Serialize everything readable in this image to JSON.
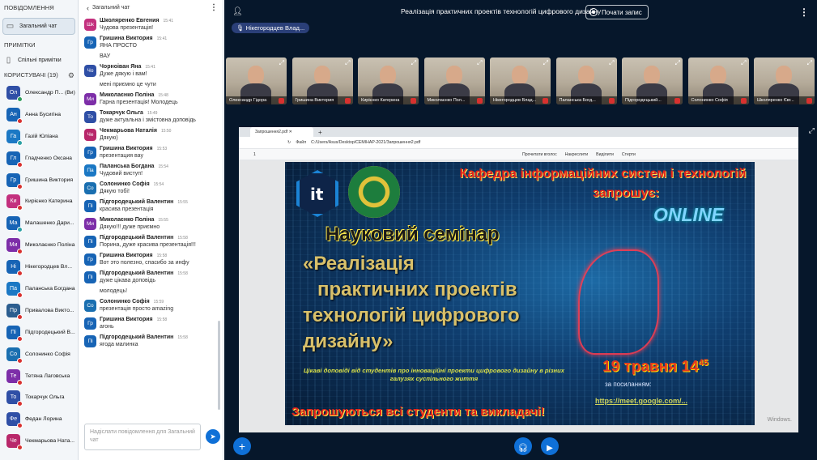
{
  "sidebar": {
    "messages_header": "ПОВІДОМЛЕННЯ",
    "general_chat": "Загальний чат",
    "notes_header": "ПРИМІТКИ",
    "shared_notes": "Спільні примітки",
    "users_header": "КОРИСТУВАЧІ (19)",
    "users": [
      {
        "initials": "Ол",
        "name": "Олександр П... (Ви)",
        "color": "#2f4fa6",
        "status": "green"
      },
      {
        "initials": "Ан",
        "name": "Анна Бусигіна",
        "color": "#1764b5",
        "status": "red"
      },
      {
        "initials": "Га",
        "name": "Газій Юліана",
        "color": "#1b78c4",
        "status": "teal"
      },
      {
        "initials": "Гл",
        "name": "Гладченко Оксана",
        "color": "#1764b5",
        "status": "red"
      },
      {
        "initials": "Гр",
        "name": "Гришина Виктория",
        "color": "#1764b5",
        "status": "red"
      },
      {
        "initials": "Ки",
        "name": "Кирiєнко Катерина",
        "color": "#c3307e",
        "status": "red"
      },
      {
        "initials": "Ма",
        "name": "Малашенко Дари...",
        "color": "#1764b5",
        "status": "teal"
      },
      {
        "initials": "Ми",
        "name": "Миколаєнко Поліна",
        "color": "#7d2ea8",
        "status": "red"
      },
      {
        "initials": "Ні",
        "name": "Нікегородцев Вл...",
        "color": "#1764b5",
        "status": "red"
      },
      {
        "initials": "Па",
        "name": "Паланська Богдана",
        "color": "#1b78c4",
        "status": "red"
      },
      {
        "initials": "Пр",
        "name": "Привалова Викто...",
        "color": "#2b5d8f",
        "status": "red"
      },
      {
        "initials": "Пі",
        "name": "Підгородецький В...",
        "color": "#1764b5",
        "status": "red"
      },
      {
        "initials": "Со",
        "name": "Солонинко Софія",
        "color": "#1a6fb0",
        "status": "red"
      },
      {
        "initials": "Те",
        "name": "Тетяна Лаговська",
        "color": "#7d2ea8",
        "status": "red"
      },
      {
        "initials": "То",
        "name": "Токарчук Ольга",
        "color": "#2f4fa6",
        "status": "red"
      },
      {
        "initials": "Фе",
        "name": "Федан Лорина",
        "color": "#2f4fa6",
        "status": "red"
      },
      {
        "initials": "Че",
        "name": "Чекмарьова Ната...",
        "color": "#b8276a",
        "status": "red"
      }
    ]
  },
  "chat": {
    "title": "Загальний чат",
    "messages": [
      {
        "initials": "Шк",
        "color": "#c3307e",
        "name": "Школяренко Евгения",
        "time": "15:41",
        "text": "Чудова презентація!"
      },
      {
        "initials": "Гр",
        "color": "#1764b5",
        "name": "Гришина Виктория",
        "time": "15:41",
        "text": "ЯНА ПРОСТО",
        "cont": "ВАУ"
      },
      {
        "initials": "Чо",
        "color": "#2f4fa6",
        "name": "Чорноіван Яна",
        "time": "15:41",
        "text": "Дуже дякую і вам!",
        "cont": "мені приємно це чути"
      },
      {
        "initials": "Ми",
        "color": "#7d2ea8",
        "name": "Миколаєнко Поліна",
        "time": "15:48",
        "text": "Гарна презентація! Молодець"
      },
      {
        "initials": "То",
        "color": "#2f4fa6",
        "name": "Токарчук Ольга",
        "time": "15:49",
        "text": "дуже актуальна і змістовна доповідь"
      },
      {
        "initials": "Че",
        "color": "#b8276a",
        "name": "Чекмарьова Наталія",
        "time": "15:50",
        "text": "Дякую)"
      },
      {
        "initials": "Гр",
        "color": "#1764b5",
        "name": "Гришина Виктория",
        "time": "15:53",
        "text": "презентация вау"
      },
      {
        "initials": "Па",
        "color": "#1b78c4",
        "name": "Паланська Богдана",
        "time": "15:54",
        "text": "Чудовий виступ!"
      },
      {
        "initials": "Со",
        "color": "#1a6fb0",
        "name": "Солонинко Софія",
        "time": "15:54",
        "text": "Дякую тобі!"
      },
      {
        "initials": "Пі",
        "color": "#1764b5",
        "name": "Підгородецький Валентин",
        "time": "15:55",
        "text": "красива презентація"
      },
      {
        "initials": "Ми",
        "color": "#7d2ea8",
        "name": "Миколаєнко Поліна",
        "time": "15:55",
        "text": "Дякую!!! дуже приємно"
      },
      {
        "initials": "Пі",
        "color": "#1764b5",
        "name": "Підгородецький Валентин",
        "time": "15:58",
        "text": "Порина, дуже красива презентація!!!"
      },
      {
        "initials": "Гр",
        "color": "#1764b5",
        "name": "Гришина Виктория",
        "time": "15:58",
        "text": "Вот это полезно, спасибо за инфу"
      },
      {
        "initials": "Пі",
        "color": "#1764b5",
        "name": "Підгородецький Валентин",
        "time": "15:58",
        "text": "дуже цікава доповідь",
        "cont": "молодець!"
      },
      {
        "initials": "Со",
        "color": "#1a6fb0",
        "name": "Солонинко Софія",
        "time": "15:59",
        "text": "презентація просто amazing"
      },
      {
        "initials": "Гр",
        "color": "#1764b5",
        "name": "Гришина Виктория",
        "time": "15:58",
        "text": "агонь"
      },
      {
        "initials": "Пі",
        "color": "#1764b5",
        "name": "Підгородецький Валентин",
        "time": "15:58",
        "text": "ягода малинка"
      }
    ],
    "input_placeholder": "Надіслати повідомлення для Загальний чат"
  },
  "meeting": {
    "title": "Реалізація практичних проектів технологій цифрового дизайну",
    "record_label": "Почати запис",
    "presenter": "Нікегородцев Влад...",
    "tiles": [
      "Олександр Гідора",
      "Гришина Виктория",
      "Кирiєнко Катерина",
      "Миколаєнко Пол...",
      "Нікегородцев Влад...",
      "Паланська Богд...",
      "Підгородецький...",
      "Солонинко Софія",
      "Школяренко Євг..."
    ]
  },
  "pdf": {
    "tab": "Запрошення2.pdf",
    "file_label": "Файл",
    "path": "C:/Users/Asus/Desktop/СЕМІНАР-2021/Запрошення2.pdf",
    "page": "1",
    "read_aloud": "Прочитати вголос",
    "draw": "Накреслити",
    "highlight": "Виділити",
    "erase": "Стерти",
    "windows_note": "Windows."
  },
  "poster": {
    "it_logo": "it",
    "dept": "Кафедра інформаційних систем і технологій",
    "invites": "запрошує:",
    "online": "ONLINE",
    "seminar": "Науковий семінар",
    "title_lines": [
      "«Реалізація",
      "практичних проектів",
      "технологій цифрового",
      "дизайну»"
    ],
    "subtitle": "Цікаві доповіді від студентів про інноваційні проекти цифрового дизайну в різних галузях суспільного життя",
    "date": "19 травня 14",
    "date_sup": "45",
    "by_link": "за посиланням:",
    "link": "https://meet.google.com/...",
    "bottom": "Запрошуються всі студенти та викладачі!"
  },
  "colors": {
    "accent": "#0f70d7",
    "main_bg": "#06172b",
    "presenter_pill": "#2a3f78"
  }
}
